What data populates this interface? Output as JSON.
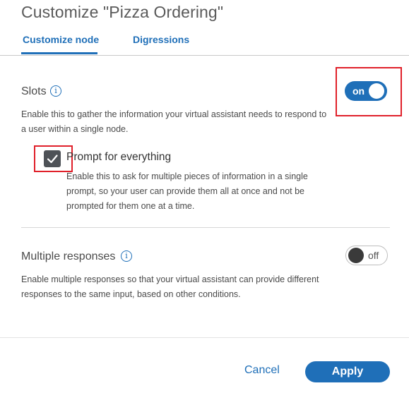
{
  "dialog": {
    "title": "Customize \"Pizza Ordering\""
  },
  "tabs": [
    {
      "label": "Customize node",
      "active": true
    },
    {
      "label": "Digressions",
      "active": false
    }
  ],
  "slots": {
    "title": "Slots",
    "info_icon": "info-icon",
    "toggle_label": "on",
    "toggle_state": true,
    "description_line1": "Enable this to gather the information your virtual assistant needs to respond to",
    "description_line2": "a user within a single node.",
    "prompt_checkbox": {
      "label": "Prompt for everything",
      "checked": true,
      "description_line1": "Enable this to ask for multiple pieces of information in a single",
      "description_line2": "prompt, so your user can provide them all at once and not be",
      "description_line3": "prompted for them one at a time."
    }
  },
  "multiple_responses": {
    "title": "Multiple responses",
    "info_icon": "info-icon",
    "toggle_label": "off",
    "toggle_state": false,
    "description_line1": "Enable multiple responses so that your virtual assistant can provide different",
    "description_line2": "responses to the same input, based on other conditions."
  },
  "footer": {
    "cancel_label": "Cancel",
    "apply_label": "Apply"
  },
  "colors": {
    "accent": "#1f6fb8",
    "highlight": "#e0202a"
  }
}
